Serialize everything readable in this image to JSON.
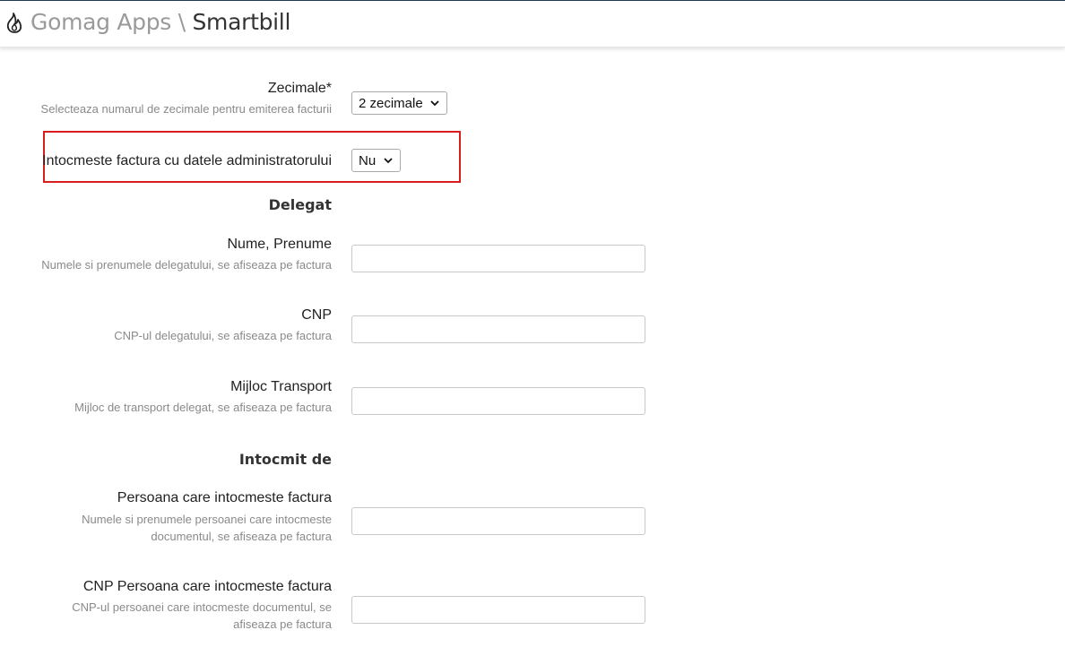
{
  "header": {
    "app_name": "Gomag Apps",
    "separator": "\\",
    "current": "Smartbill",
    "icon": "flame-icon"
  },
  "form": {
    "zecimale": {
      "label": "Zecimale*",
      "help": "Selecteaza numarul de zecimale pentru emiterea facturii",
      "value": "2 zecimale"
    },
    "admin_data": {
      "label": "Intocmeste factura cu datele administratorului",
      "value": "Nu"
    },
    "delegat_section": "Delegat",
    "nume_prenume": {
      "label": "Nume, Prenume",
      "help": "Numele si prenumele delegatului, se afiseaza pe factura",
      "value": ""
    },
    "cnp": {
      "label": "CNP",
      "help": "CNP-ul delegatului, se afiseaza pe factura",
      "value": ""
    },
    "mijloc_transport": {
      "label": "Mijloc Transport",
      "help": "Mijloc de transport delegat, se afiseaza pe factura",
      "value": ""
    },
    "intocmit_section": "Intocmit de",
    "persoana": {
      "label": "Persoana care intocmeste factura",
      "help_line1": "Numele si prenumele persoanei care intocmeste",
      "help_line2": "documentul, se afiseaza pe factura",
      "value": ""
    },
    "cnp_persoana": {
      "label": "CNP Persoana care intocmeste factura",
      "help_line1": "CNP-ul persoanei care intocmeste documentul, se",
      "help_line2": "afiseaza pe factura",
      "value": ""
    }
  },
  "colors": {
    "highlight_border": "#d91c1c",
    "header_line": "#1f3a5a"
  }
}
